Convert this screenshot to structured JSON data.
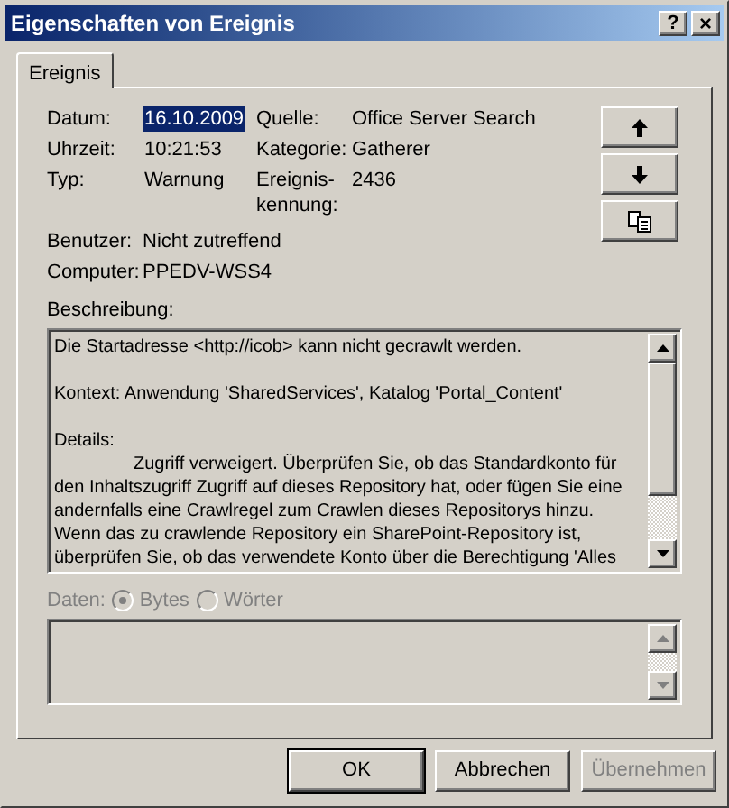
{
  "window": {
    "title": "Eigenschaften von Ereignis",
    "help": "?",
    "close": "×"
  },
  "tabs": [
    {
      "label": "Ereignis",
      "selected": true
    }
  ],
  "fields": [
    {
      "label": "Datum:",
      "value": "16.10.2009",
      "highlighted": true
    },
    {
      "label": "Uhrzeit:",
      "value": "10:21:53",
      "highlighted": false
    },
    {
      "label": "Typ:",
      "value": "Warnung",
      "highlighted": false
    }
  ],
  "fields_right": [
    {
      "label": "Quelle:",
      "value": "Office Server Search"
    },
    {
      "label": "Kategorie:",
      "value": "Gatherer"
    },
    {
      "label": "Ereignis-\nkennung:",
      "value": "2436"
    }
  ],
  "fields_bottom": [
    {
      "label": "Benutzer:",
      "value": "Nicht zutreffend"
    },
    {
      "label": "Computer:",
      "value": "PPEDV-WSS4"
    }
  ],
  "side_buttons": [
    {
      "kind": "up"
    },
    {
      "kind": "down"
    },
    {
      "kind": "copy"
    }
  ],
  "description": {
    "label": "Beschreibung:",
    "paragraphs": [
      {
        "lines": [
          {
            "text": "Die Startadresse <http://icob> kann nicht gecrawlt werden.",
            "indent": false
          }
        ]
      },
      {
        "lines": [
          {
            "text": "Kontext: Anwendung 'SharedServices', Katalog 'Portal_Content'",
            "indent": false
          }
        ]
      },
      {
        "lines": [
          {
            "text": "Details:",
            "indent": false
          },
          {
            "text": "Zugriff verweigert. Überprüfen Sie, ob das Standardkonto für",
            "indent": true
          },
          {
            "text": "den Inhaltszugriff Zugriff auf dieses Repository hat, oder fügen Sie eine",
            "indent": false
          },
          {
            "text": "andernfalls eine Crawlregel zum Crawlen dieses Repositorys hinzu.",
            "indent": false
          },
          {
            "text": "Wenn das zu crawlende Repository ein SharePoint-Repository ist,",
            "indent": false
          },
          {
            "text": "überprüfen Sie, ob das verwendete Konto über die Berechtigung 'Alles",
            "indent": false
          }
        ]
      }
    ]
  },
  "data": {
    "label": "Daten:",
    "disabled": true,
    "options": [
      {
        "label": "Bytes",
        "selected": true
      },
      {
        "label": "Wörter",
        "selected": false
      }
    ]
  },
  "buttons": [
    {
      "label": "OK",
      "default": true,
      "disabled": false
    },
    {
      "label": "Abbrechen",
      "default": false,
      "disabled": false
    },
    {
      "label": "Übernehmen",
      "default": false,
      "disabled": true
    }
  ]
}
